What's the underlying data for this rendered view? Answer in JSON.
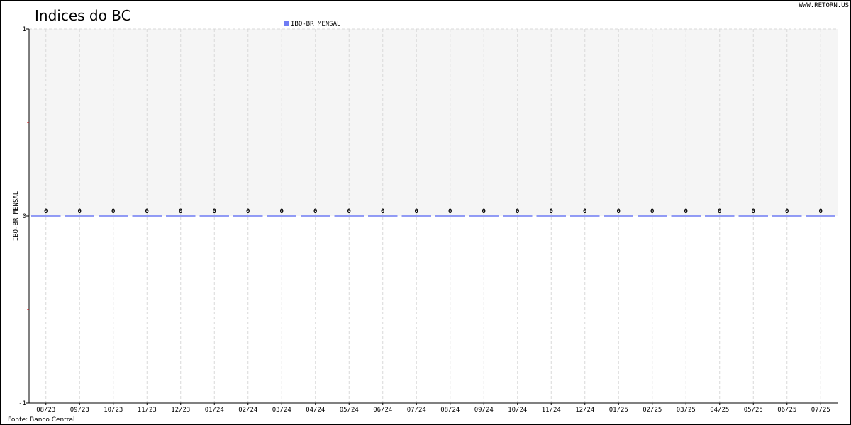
{
  "watermark": "WWW.RETORN.US",
  "source": "Fonte: Banco Central",
  "colors": {
    "series": "#6f7cf4",
    "plot_bg": "#f5f5f5",
    "grid": "#d9d9d9"
  },
  "chart_data": {
    "type": "bar",
    "title": "Indices do BC",
    "ylabel": "IBO-BR MENSAL",
    "ylim": [
      -1,
      1
    ],
    "yticks": [
      "1",
      "0",
      "-1"
    ],
    "grid": true,
    "legend": "top-center",
    "categories": [
      "08/23",
      "09/23",
      "10/23",
      "11/23",
      "12/23",
      "01/24",
      "02/24",
      "03/24",
      "04/24",
      "05/24",
      "06/24",
      "07/24",
      "08/24",
      "09/24",
      "10/24",
      "11/24",
      "12/24",
      "01/25",
      "02/25",
      "03/25",
      "04/25",
      "05/25",
      "06/25",
      "07/25"
    ],
    "series": [
      {
        "name": "IBO-BR MENSAL",
        "values": [
          0,
          0,
          0,
          0,
          0,
          0,
          0,
          0,
          0,
          0,
          0,
          0,
          0,
          0,
          0,
          0,
          0,
          0,
          0,
          0,
          0,
          0,
          0,
          0
        ],
        "labels": [
          "0",
          "0",
          "0",
          "0",
          "0",
          "0",
          "0",
          "0",
          "0",
          "0",
          "0",
          "0",
          "0",
          "0",
          "0",
          "0",
          "0",
          "0",
          "0",
          "0",
          "0",
          "0",
          "0",
          "0"
        ]
      }
    ]
  }
}
